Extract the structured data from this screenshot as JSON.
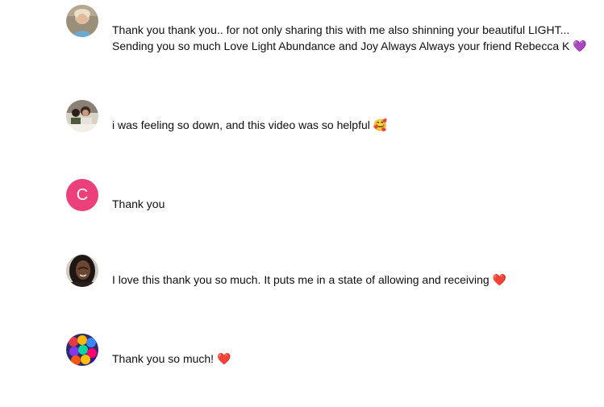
{
  "comments": [
    {
      "author_avatar": "photo-avatar-blonde-woman",
      "text_line1": "Thank you thank you.. for not only sharing this with me also shinning your beautiful LIGHT...",
      "text_line2": "Sending you so much Love Light Abundance and Joy Always Always your friend Rebecca K",
      "emoji": "💜"
    },
    {
      "author_avatar": "photo-avatar-group",
      "text": "i was feeling so down, and this video was so helpful",
      "emoji": "🥰"
    },
    {
      "author_avatar": "letter-avatar",
      "avatar_letter": "C",
      "avatar_color": "#ec407a",
      "text": "Thank you"
    },
    {
      "author_avatar": "photo-avatar-woman-braids",
      "text": "I love this thank you so much. It puts me in a state of allowing and receiving",
      "emoji": "❤️"
    },
    {
      "author_avatar": "photo-avatar-colorful-balls",
      "text": "Thank you so much!",
      "emoji": "❤️"
    }
  ]
}
